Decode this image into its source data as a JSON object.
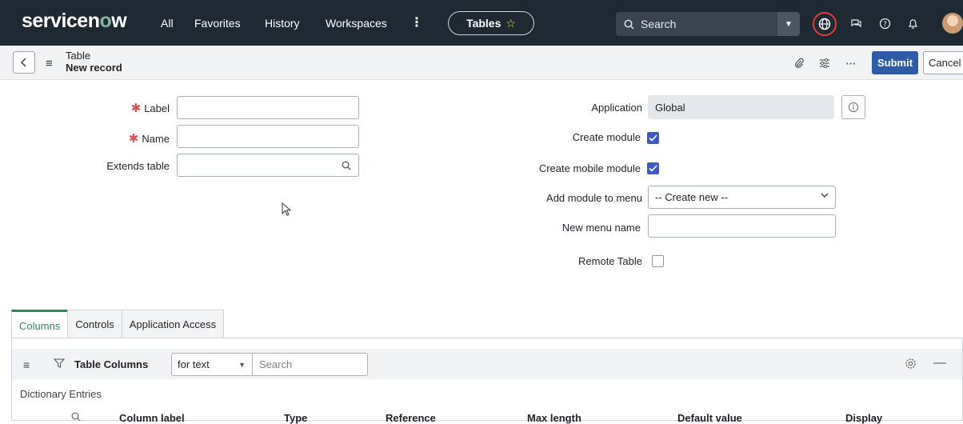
{
  "nav": {
    "logo_main": "servicen",
    "logo_accent": "o",
    "logo_end": "w",
    "links": [
      "All",
      "Favorites",
      "History",
      "Workspaces"
    ],
    "tables_pill": "Tables",
    "search_placeholder": "Search"
  },
  "record": {
    "title": "Table",
    "subtitle": "New record",
    "submit": "Submit",
    "cancel": "Cancel"
  },
  "form": {
    "label": "Label",
    "name": "Name",
    "extends_table": "Extends table",
    "application": "Application",
    "application_value": "Global",
    "create_module": "Create module",
    "create_module_checked": true,
    "create_mobile_module": "Create mobile module",
    "create_mobile_module_checked": true,
    "add_module_to_menu": "Add module to menu",
    "add_module_value": "-- Create new --",
    "new_menu_name": "New menu name",
    "remote_table": "Remote Table",
    "remote_table_checked": false
  },
  "related": {
    "tabs": [
      "Columns",
      "Controls",
      "Application Access"
    ],
    "active_tab": "Columns",
    "list_title": "Table Columns",
    "filter_select": "for text",
    "search_placeholder": "Search",
    "breadcrumb": "Dictionary Entries",
    "columns": [
      "Column label",
      "Type",
      "Reference",
      "Max length",
      "Default value",
      "Display"
    ]
  },
  "colors": {
    "nav_bg": "#1f2933",
    "accent_green": "#81b5a1",
    "submit_blue": "#2f5aa5",
    "checkbox_blue": "#3b5cc4",
    "required_red": "#d9534f",
    "tab_active": "#2e8b57"
  }
}
